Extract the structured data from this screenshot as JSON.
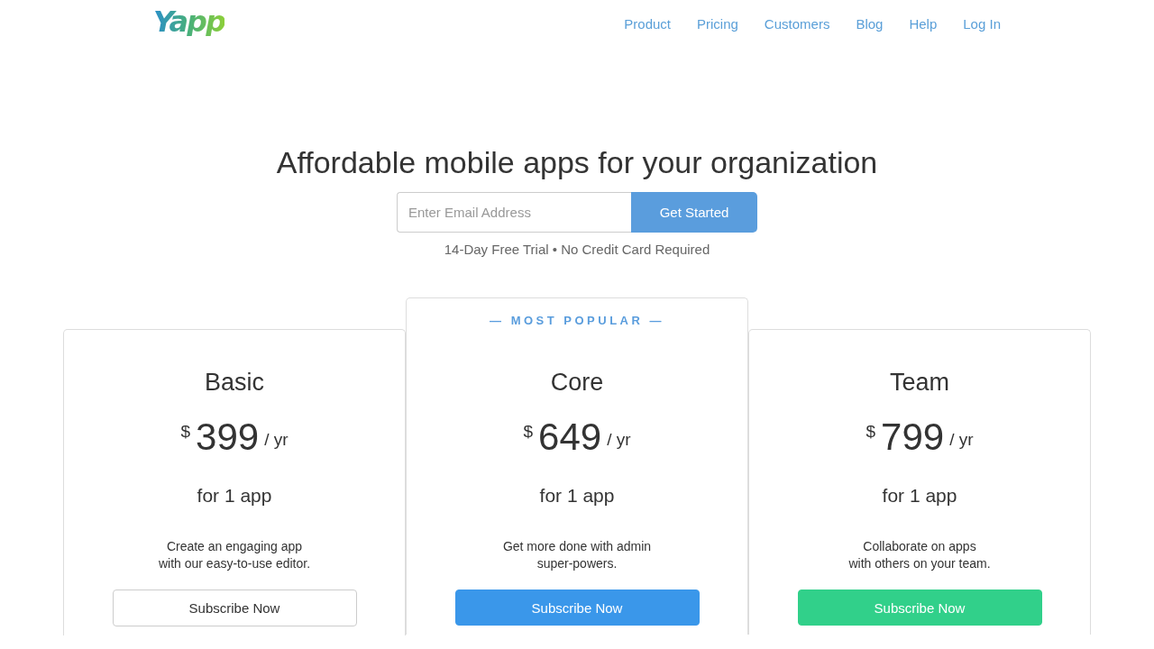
{
  "header": {
    "logo": "Yapp",
    "nav": [
      {
        "label": "Product"
      },
      {
        "label": "Pricing"
      },
      {
        "label": "Customers"
      },
      {
        "label": "Blog"
      },
      {
        "label": "Help"
      },
      {
        "label": "Log In"
      }
    ]
  },
  "hero": {
    "title": "Affordable mobile apps for your organization",
    "email": {
      "placeholder": "Enter Email Address"
    },
    "button": "Get Started",
    "note": "14-Day Free Trial • No Credit Card Required"
  },
  "plans": [
    {
      "name": "Basic",
      "currency": "$",
      "price": "399",
      "period": "/ yr",
      "scope": "for 1 app",
      "description": [
        "Create an engaging app",
        "with our easy-to-use editor."
      ],
      "button": {
        "label": "Subscribe Now",
        "kind": "outline"
      }
    },
    {
      "badge": "— MOST POPULAR —",
      "name": "Core",
      "currency": "$",
      "price": "649",
      "period": "/ yr",
      "scope": "for 1 app",
      "description": [
        "Get more done with admin",
        "super-powers."
      ],
      "button": {
        "label": "Subscribe Now",
        "kind": "primary"
      }
    },
    {
      "name": "Team",
      "currency": "$",
      "price": "799",
      "period": "/ yr",
      "scope": "for 1 app",
      "description": [
        "Collaborate on apps",
        "with others on your team."
      ],
      "button": {
        "label": "Subscribe Now",
        "kind": "success"
      }
    }
  ]
}
